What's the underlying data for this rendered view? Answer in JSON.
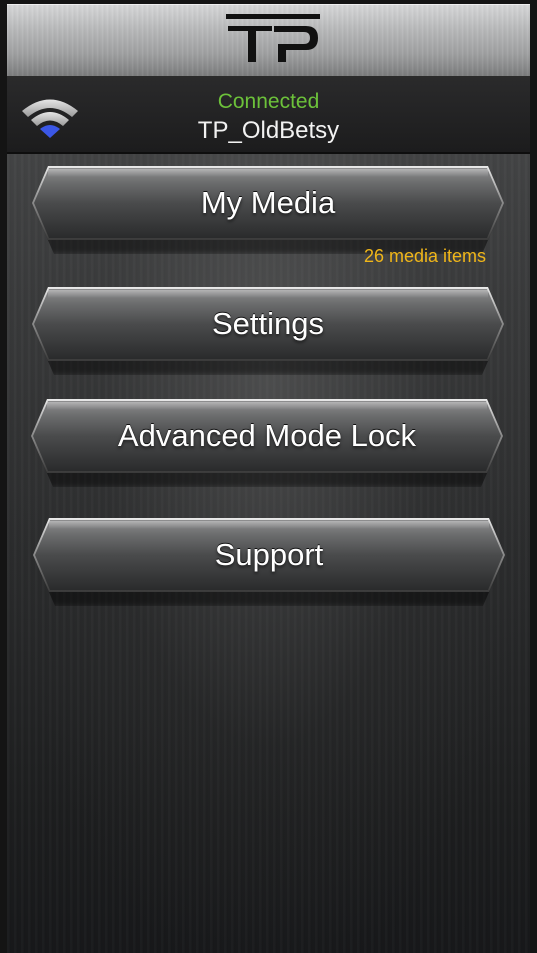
{
  "header": {
    "logo_icon": "tp-logo-icon"
  },
  "status": {
    "wifi_icon": "wifi-icon",
    "connection_label": "Connected",
    "network_name": "TP_OldBetsy",
    "connected_color": "#6cc13a"
  },
  "menu": {
    "my_media": "My Media",
    "media_count": "26 media items",
    "settings": "Settings",
    "advanced_mode_lock": "Advanced Mode Lock",
    "support": "Support"
  },
  "colors": {
    "media_count": "#f0b619",
    "wifi_blue": "#3b57e6",
    "button_text": "#ffffff"
  }
}
